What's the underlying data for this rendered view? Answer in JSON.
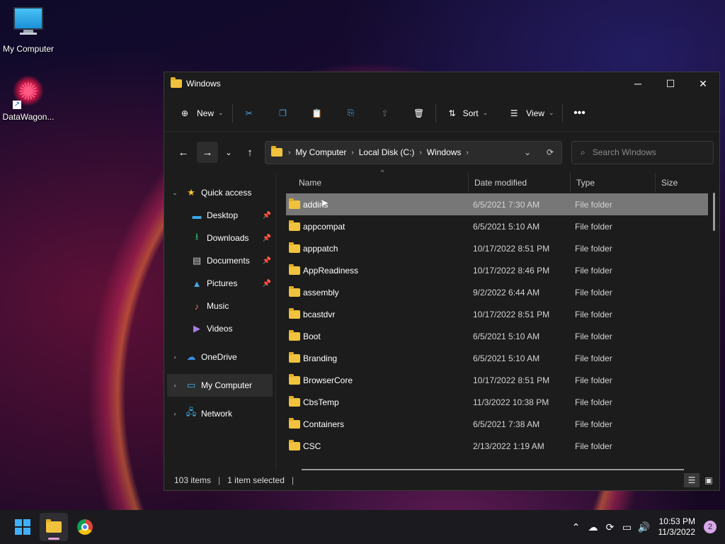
{
  "desktop": {
    "icons": [
      {
        "label": "My Computer"
      },
      {
        "label": "DataWagon..."
      }
    ]
  },
  "window": {
    "title": "Windows",
    "toolbar": {
      "new_label": "New",
      "sort_label": "Sort",
      "view_label": "View"
    },
    "breadcrumb": [
      "My Computer",
      "Local Disk (C:)",
      "Windows"
    ],
    "search_placeholder": "Search Windows",
    "nav": {
      "quick_access": "Quick access",
      "desktop": "Desktop",
      "downloads": "Downloads",
      "documents": "Documents",
      "pictures": "Pictures",
      "music": "Music",
      "videos": "Videos",
      "onedrive": "OneDrive",
      "my_computer": "My Computer",
      "network": "Network"
    },
    "columns": {
      "name": "Name",
      "date": "Date modified",
      "type": "Type",
      "size": "Size"
    },
    "files": [
      {
        "name": "addins",
        "date": "6/5/2021 7:30 AM",
        "type": "File folder"
      },
      {
        "name": "appcompat",
        "date": "6/5/2021 5:10 AM",
        "type": "File folder"
      },
      {
        "name": "apppatch",
        "date": "10/17/2022 8:51 PM",
        "type": "File folder"
      },
      {
        "name": "AppReadiness",
        "date": "10/17/2022 8:46 PM",
        "type": "File folder"
      },
      {
        "name": "assembly",
        "date": "9/2/2022 6:44 AM",
        "type": "File folder"
      },
      {
        "name": "bcastdvr",
        "date": "10/17/2022 8:51 PM",
        "type": "File folder"
      },
      {
        "name": "Boot",
        "date": "6/5/2021 5:10 AM",
        "type": "File folder"
      },
      {
        "name": "Branding",
        "date": "6/5/2021 5:10 AM",
        "type": "File folder"
      },
      {
        "name": "BrowserCore",
        "date": "10/17/2022 8:51 PM",
        "type": "File folder"
      },
      {
        "name": "CbsTemp",
        "date": "11/3/2022 10:38 PM",
        "type": "File folder"
      },
      {
        "name": "Containers",
        "date": "6/5/2021 7:38 AM",
        "type": "File folder"
      },
      {
        "name": "CSC",
        "date": "2/13/2022 1:19 AM",
        "type": "File folder"
      }
    ],
    "status": {
      "items": "103 items",
      "selected": "1 item selected"
    }
  },
  "taskbar": {
    "time": "10:53 PM",
    "date": "11/3/2022",
    "notifications": "2"
  }
}
